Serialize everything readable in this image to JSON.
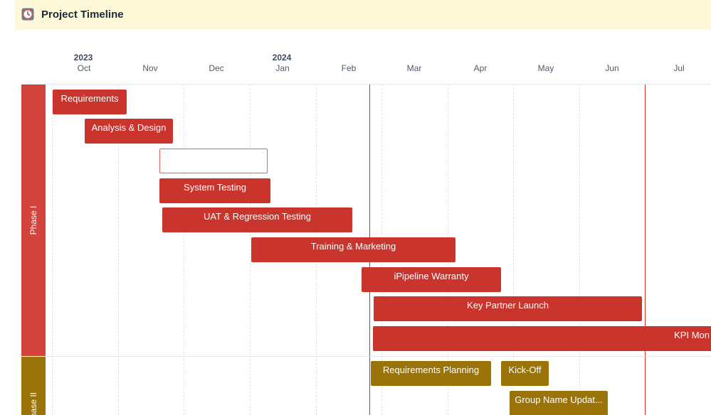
{
  "header": {
    "title": "Project Timeline",
    "icon": "clock-app-icon"
  },
  "timeline": {
    "years": [
      "2023",
      "2024"
    ],
    "months": [
      "Oct",
      "Nov",
      "Dec",
      "Jan",
      "Feb",
      "Mar",
      "Apr",
      "May",
      "Jun",
      "Jul"
    ]
  },
  "phases": [
    {
      "label": "Phase I",
      "color": "#d2443c",
      "tasks": [
        {
          "label": "Requirements"
        },
        {
          "label": "Analysis & Design"
        },
        {
          "label": ""
        },
        {
          "label": "System Testing"
        },
        {
          "label": "UAT & Regression Testing"
        },
        {
          "label": "Training & Marketing"
        },
        {
          "label": "iPipeline Warranty"
        },
        {
          "label": "Key Partner Launch"
        },
        {
          "label": "KPI Mon"
        }
      ]
    },
    {
      "label": "Phase II",
      "color": "#9a7408",
      "tasks": [
        {
          "label": "Requirements Planning"
        },
        {
          "label": "Kick-Off"
        },
        {
          "label": "Group Name Updat..."
        }
      ]
    }
  ]
}
